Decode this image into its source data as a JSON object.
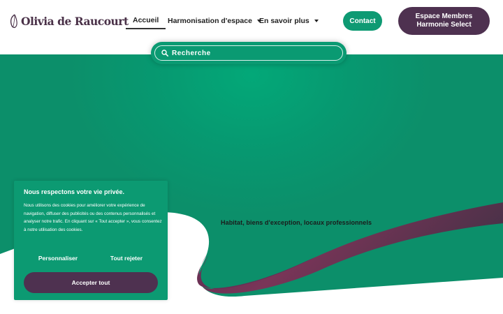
{
  "header": {
    "logo_text": "Olivia de Raucourt",
    "nav": [
      {
        "label": "Accueil",
        "active": true
      },
      {
        "label": "Harmonisation d'espace",
        "has_dropdown": true
      },
      {
        "label": "En savoir plus",
        "has_dropdown": true
      }
    ],
    "contact_label": "Contact",
    "members_line1": "Espace Membres",
    "members_line2": "Harmonie Select"
  },
  "search": {
    "placeholder": "Recherche",
    "icon": "search-icon"
  },
  "hero": {
    "tagline": "Habitat, biens d'exception, locaux professionnels"
  },
  "cookie": {
    "title": "Nous respectons votre vie privée.",
    "body": "Nous utilisons des cookies pour améliorer votre expérience de navigation, diffuser des publicités ou des contenus personnalisés et analyser notre trafic. En cliquant sur « Tout accepter », vous consentez à notre utilisation des cookies.",
    "customize_label": "Personnaliser",
    "reject_label": "Tout rejeter",
    "accept_label": "Accepter tout"
  },
  "colors": {
    "brand_green": "#0c9a72",
    "brand_plum": "#4e3150",
    "wave_plum_dark": "#4a3148",
    "wave_magenta": "#7a3558"
  }
}
